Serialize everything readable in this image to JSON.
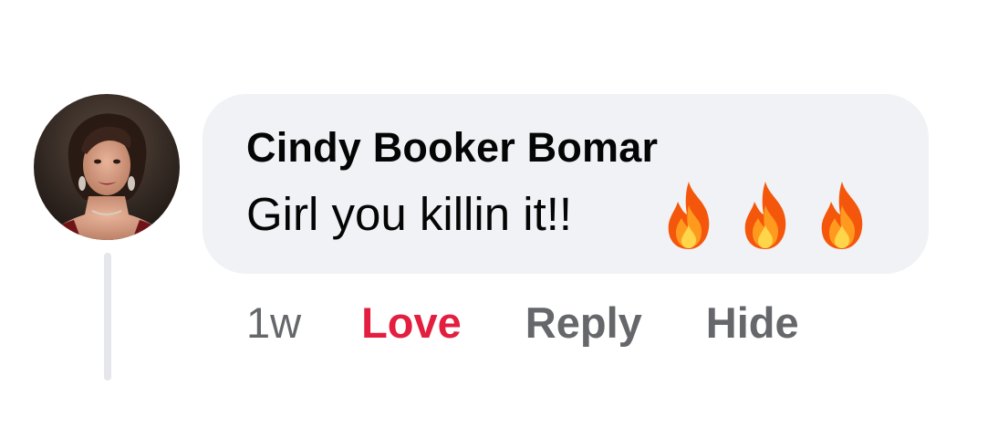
{
  "comment": {
    "author": "Cindy Booker Bomar",
    "text": "Girl you killin it!!",
    "reactions": [
      "fire-icon",
      "fire-icon",
      "fire-icon"
    ],
    "timestamp": "1w",
    "actions": {
      "love": "Love",
      "reply": "Reply",
      "hide": "Hide"
    }
  },
  "colors": {
    "bubble": "#f0f2f5",
    "love_active": "#e41e3f",
    "secondary_text": "#65676b",
    "primary_text": "#050505",
    "thread_line": "#e4e6eb"
  }
}
